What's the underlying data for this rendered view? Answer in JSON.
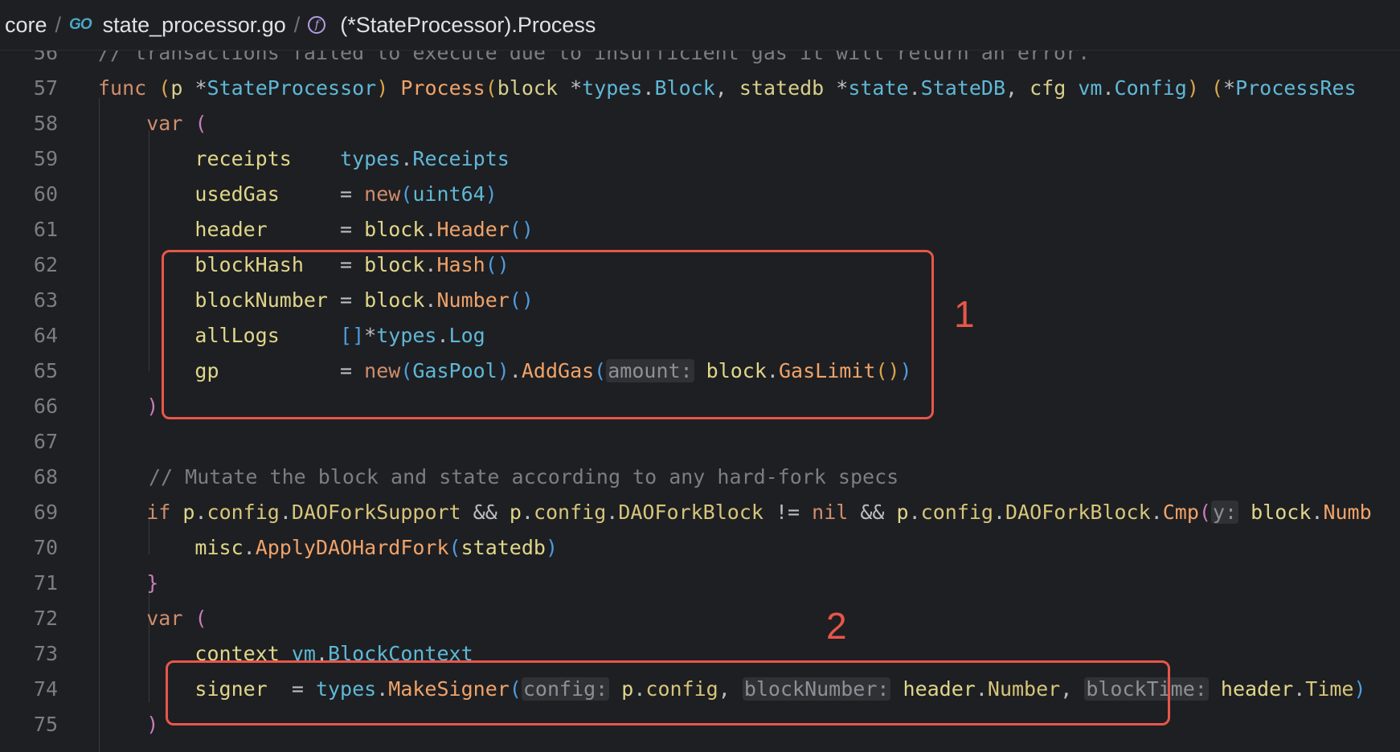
{
  "breadcrumb": {
    "root": "core",
    "file_icon": "go-icon",
    "file": "state_processor.go",
    "func_icon": "function-icon",
    "func": "(*StateProcessor).Process",
    "separator": "/"
  },
  "gutter": [
    "56",
    "57",
    "58",
    "59",
    "60",
    "61",
    "62",
    "63",
    "64",
    "65",
    "66",
    "67",
    "68",
    "69",
    "70",
    "71",
    "72",
    "73",
    "74",
    "75"
  ],
  "code": {
    "l56": "// transactions failed to execute due to insufficient gas it will return an error.",
    "l68": "// Mutate the block and state according to any hard-fork specs"
  },
  "annotations": {
    "box1_label": "1",
    "box2_label": "2"
  },
  "colors": {
    "background": "#1e1f22",
    "annotation": "#e8564a",
    "keyword": "#cf8e6d",
    "type": "#5fb8d8",
    "function": "#f0a36a"
  }
}
